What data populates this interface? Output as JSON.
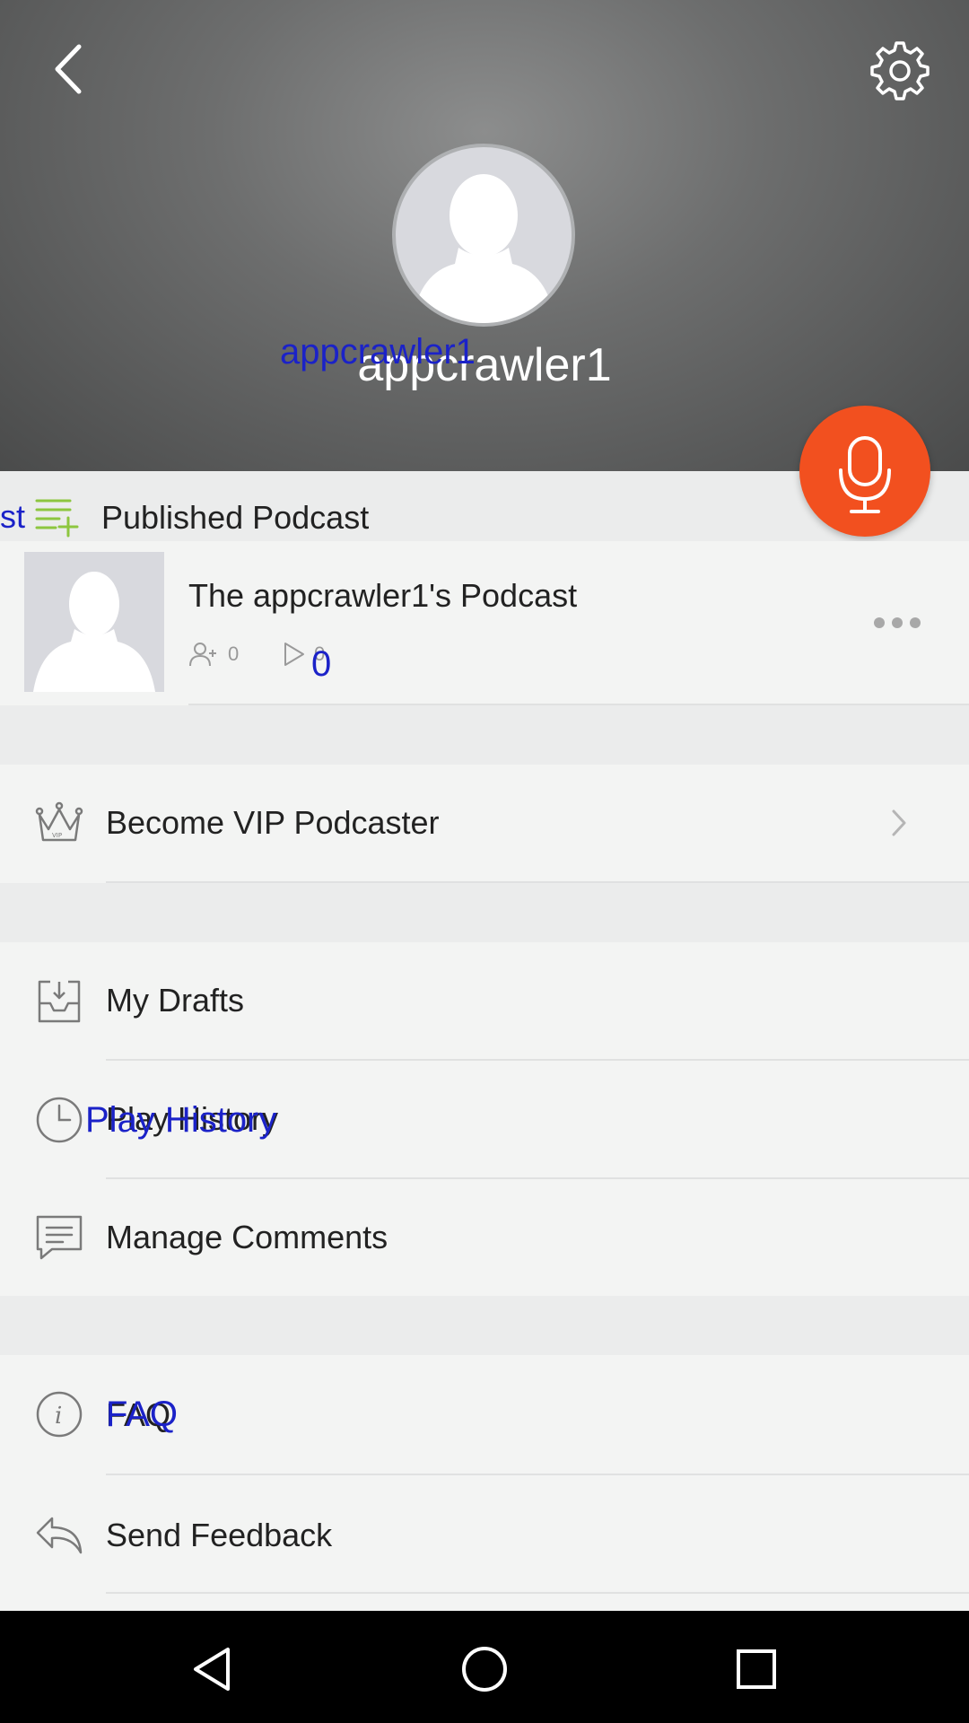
{
  "header": {
    "username": "appcrawler1",
    "username_overlay": "appcrawler1"
  },
  "section": {
    "cut_label": "st",
    "title": "Published Podcast"
  },
  "podcast": {
    "title": "The appcrawler1's Podcast",
    "subscribers": "0",
    "plays": "0",
    "plays_overlay": "0"
  },
  "menu": {
    "vip": "Become VIP Podcaster",
    "drafts": "My Drafts",
    "history": "Play History",
    "history_overlay": "Play History",
    "comments": "Manage Comments",
    "faq": "FAQ",
    "faq_overlay": "FAQ",
    "feedback": "Send Feedback"
  },
  "colors": {
    "accent": "#f2501f",
    "overlay_text": "#1b22c8",
    "section_icon": "#8dc63f"
  }
}
